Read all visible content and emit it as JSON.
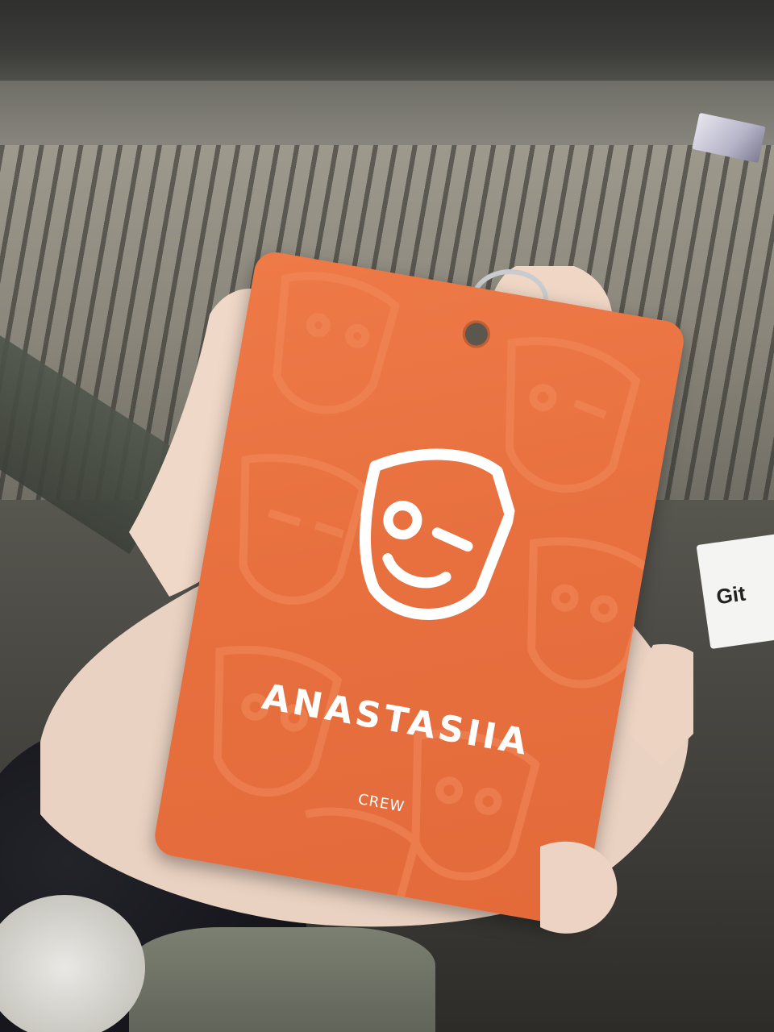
{
  "badge": {
    "name": "ANASTASIIA",
    "role": "CREW",
    "card_color": "#e8703f",
    "text_color": "#ffffff"
  },
  "background_tag": {
    "partial_text": "Git"
  },
  "icons": {
    "logo": "winking-shield-mask-icon",
    "pattern": "shield-face-pattern"
  }
}
